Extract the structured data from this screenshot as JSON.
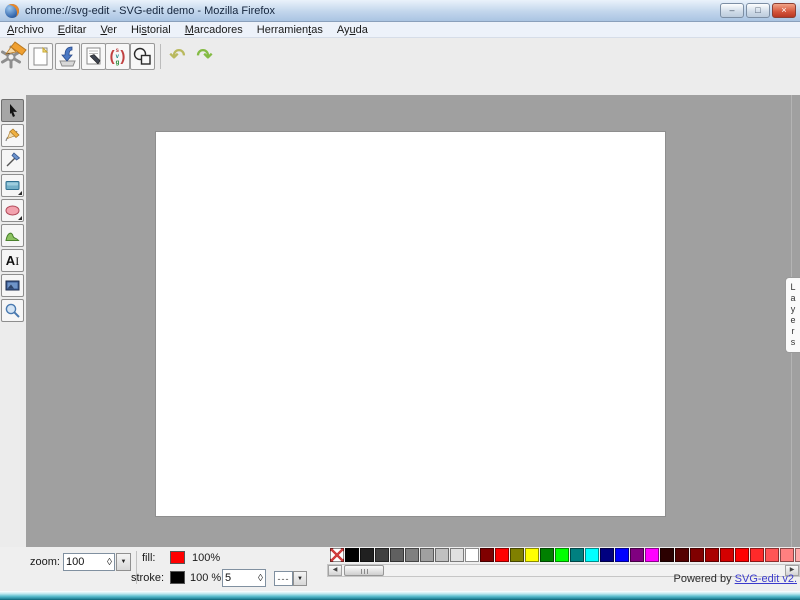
{
  "window": {
    "title": "chrome://svg-edit - SVG-edit demo - Mozilla Firefox",
    "controls": {
      "minimize": "–",
      "maximize": "□",
      "close": "×"
    }
  },
  "menubar": {
    "items": [
      {
        "pre": "",
        "key": "A",
        "post": "rchivo"
      },
      {
        "pre": "",
        "key": "E",
        "post": "ditar"
      },
      {
        "pre": "",
        "key": "V",
        "post": "er"
      },
      {
        "pre": "Hi",
        "key": "s",
        "post": "torial"
      },
      {
        "pre": "",
        "key": "M",
        "post": "arcadores"
      },
      {
        "pre": "Herramien",
        "key": "t",
        "post": "as"
      },
      {
        "pre": "Ay",
        "key": "u",
        "post": "da"
      }
    ]
  },
  "toolbar": {
    "buttons": [
      "svg-edit-logo",
      "new-image",
      "open-image",
      "save-image",
      "view-source",
      "document-properties",
      "undo",
      "redo"
    ],
    "undo_glyph": "↶",
    "redo_glyph": "↷",
    "source_icon": {
      "open": "(",
      "s": "s",
      "v": "v",
      "g": "g",
      "close": ")"
    }
  },
  "tools": [
    "select",
    "pencil",
    "line",
    "rectangle",
    "ellipse",
    "path",
    "text",
    "image",
    "zoom"
  ],
  "text_tool": {
    "letter": "A",
    "ibeam": "I"
  },
  "layers_panel": {
    "label": "Layers"
  },
  "bottom": {
    "zoom_label": "zoom:",
    "zoom_value": "100",
    "fill_label": "fill:",
    "fill_color": "#ff0000",
    "fill_opacity": "100%",
    "stroke_label": "stroke:",
    "stroke_color": "#000000",
    "stroke_opacity": "100 %",
    "stroke_width": "5",
    "stroke_dash": "---",
    "palette": [
      "none",
      "#000000",
      "#202020",
      "#404040",
      "#606060",
      "#808080",
      "#a0a0a0",
      "#c0c0c0",
      "#e0e0e0",
      "#ffffff",
      "#800000",
      "#ff0000",
      "#808000",
      "#ffff00",
      "#008000",
      "#00ff00",
      "#008080",
      "#00ffff",
      "#000080",
      "#0000ff",
      "#800080",
      "#ff00ff",
      "#2b0000",
      "#550000",
      "#800000",
      "#aa0000",
      "#d40000",
      "#ff0000",
      "#ff2a2a",
      "#ff5555",
      "#ff8080",
      "#ffaaaa",
      "#ffd5d5",
      "#2b1100",
      "#552200"
    ],
    "powered_by_text": "Powered by ",
    "powered_by_link": "SVG-edit v2."
  },
  "ui_icons": {
    "spinner": "◊",
    "dropdown": "▼",
    "scroll_left": "◀",
    "scroll_right": "▶"
  },
  "colors": {
    "workspace": "#a0a0a0",
    "panel": "#ececec",
    "canvas": "#ffffff"
  }
}
